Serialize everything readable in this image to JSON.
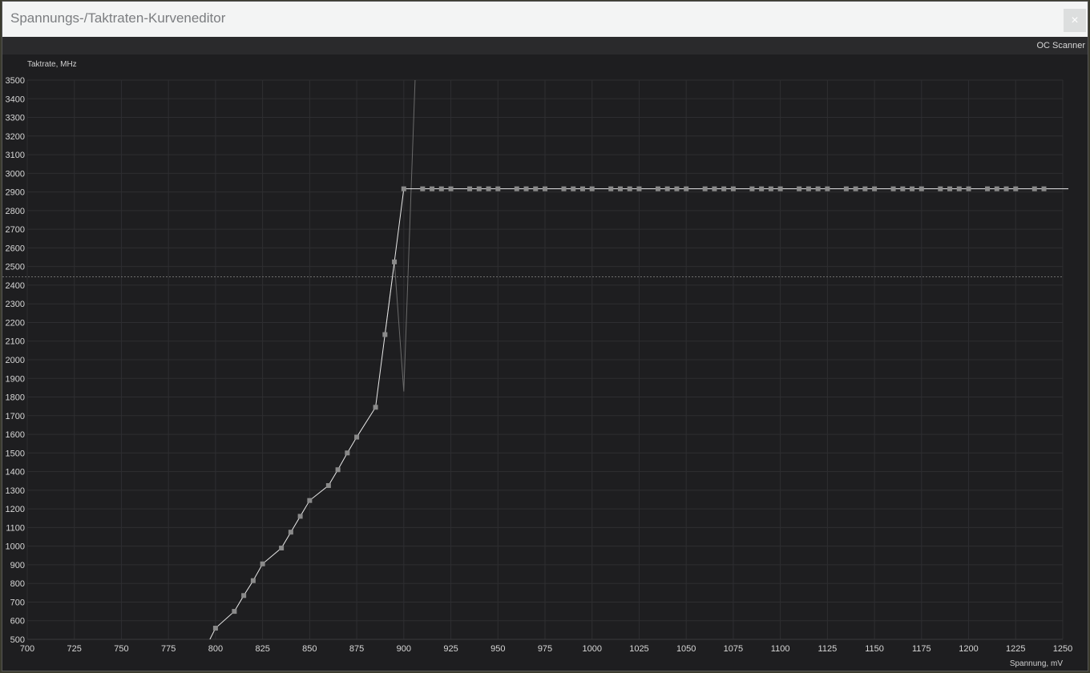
{
  "window": {
    "title": "Spannungs-/Taktraten-Kurveneditor",
    "close_label": "×"
  },
  "toolbar": {
    "oc_scanner_label": "OC Scanner"
  },
  "colors": {
    "background": "#1e1e20",
    "grid": "#2e2e31",
    "curve": "#e8e8e8",
    "point": "#8a8a8a",
    "ghost_curve": "#6a6a6a",
    "limit_line": "#6f6f6f"
  },
  "chart_data": {
    "type": "line",
    "ylabel": "Taktrate, MHz",
    "xlabel": "Spannung, mV",
    "xlim": [
      700,
      1250
    ],
    "ylim": [
      500,
      3500
    ],
    "x_ticks": [
      700,
      725,
      750,
      775,
      800,
      825,
      850,
      875,
      900,
      925,
      950,
      975,
      1000,
      1025,
      1050,
      1075,
      1100,
      1125,
      1150,
      1175,
      1200,
      1225,
      1250
    ],
    "y_ticks": [
      500,
      600,
      700,
      800,
      900,
      1000,
      1100,
      1200,
      1300,
      1400,
      1500,
      1600,
      1700,
      1800,
      1900,
      2000,
      2100,
      2200,
      2300,
      2400,
      2500,
      2600,
      2700,
      2800,
      2900,
      3000,
      3100,
      3200,
      3300,
      3400,
      3500
    ],
    "grid": true,
    "reference_line_mhz": 2445,
    "curve": {
      "x": [
        797,
        800,
        810,
        815,
        820,
        825,
        835,
        840,
        845,
        850,
        860,
        865,
        870,
        875,
        885,
        890,
        895,
        900,
        1253
      ],
      "y": [
        500,
        560,
        650,
        735,
        815,
        905,
        990,
        1075,
        1160,
        1245,
        1325,
        1410,
        1500,
        1585,
        1745,
        2135,
        2525,
        2917,
        2917
      ]
    },
    "points_x": [
      800,
      810,
      815,
      820,
      825,
      835,
      840,
      845,
      850,
      860,
      865,
      870,
      875,
      885,
      890,
      895,
      900,
      910,
      915,
      920,
      925,
      935,
      940,
      945,
      950,
      960,
      965,
      970,
      975,
      985,
      990,
      995,
      1000,
      1010,
      1015,
      1020,
      1025,
      1035,
      1040,
      1045,
      1050,
      1060,
      1065,
      1070,
      1075,
      1085,
      1090,
      1095,
      1100,
      1110,
      1115,
      1120,
      1125,
      1135,
      1140,
      1145,
      1150,
      1160,
      1165,
      1170,
      1175,
      1185,
      1190,
      1195,
      1200,
      1210,
      1215,
      1220,
      1225,
      1235,
      1240
    ],
    "points_y": [
      560,
      650,
      735,
      815,
      905,
      990,
      1075,
      1160,
      1245,
      1325,
      1410,
      1500,
      1585,
      1745,
      2135,
      2525,
      2917,
      2917,
      2917,
      2917,
      2917,
      2917,
      2917,
      2917,
      2917,
      2917,
      2917,
      2917,
      2917,
      2917,
      2917,
      2917,
      2917,
      2917,
      2917,
      2917,
      2917,
      2917,
      2917,
      2917,
      2917,
      2917,
      2917,
      2917,
      2917,
      2917,
      2917,
      2917,
      2917,
      2917,
      2917,
      2917,
      2917,
      2917,
      2917,
      2917,
      2917,
      2917,
      2917,
      2917,
      2917,
      2917,
      2917,
      2917,
      2917,
      2917,
      2917,
      2917,
      2917,
      2917,
      2917
    ],
    "ghost_curve": {
      "x": [
        890,
        895,
        900,
        906
      ],
      "y": [
        2135,
        2525,
        1830,
        3500
      ]
    }
  }
}
